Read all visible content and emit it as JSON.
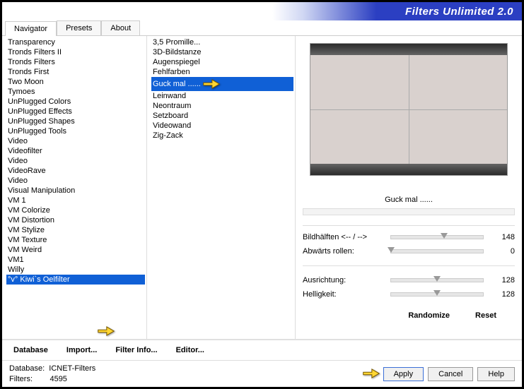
{
  "title": "Filters Unlimited 2.0",
  "tabs": [
    "Navigator",
    "Presets",
    "About"
  ],
  "active_tab": 0,
  "left_list": [
    "Transparency",
    "Tronds Filters II",
    "Tronds Filters",
    "Tronds First",
    "Two Moon",
    "Tymoes",
    "UnPlugged Colors",
    "UnPlugged Effects",
    "UnPlugged Shapes",
    "UnPlugged Tools",
    "Video",
    "Videofilter",
    "Video",
    "VideoRave",
    "Video",
    "Visual Manipulation",
    "VM 1",
    "VM Colorize",
    "VM Distortion",
    "VM Stylize",
    "VM Texture",
    "VM Weird",
    "VM1",
    "Willy",
    "°v° Kiwi`s Oelfilter"
  ],
  "left_selected": 24,
  "mid_list": [
    "3,5 Promille...",
    "3D-Bildstanze",
    "Augenspiegel",
    "Fehlfarben",
    "Guck mal ......",
    "Leinwand",
    "Neontraum",
    "Setzboard",
    "Videowand",
    "Zig-Zack"
  ],
  "mid_selected": 4,
  "bottom_buttons": [
    "Database",
    "Import...",
    "Filter Info...",
    "Editor..."
  ],
  "right_buttons": [
    "Randomize",
    "Reset"
  ],
  "current_filter": "Guck mal ......",
  "params": [
    {
      "label": "Bildhälften <-- / -->",
      "value": 148,
      "pos": 58
    },
    {
      "label": "Abwärts rollen:",
      "value": 0,
      "pos": 0
    },
    {
      "label": "Ausrichtung:",
      "value": 128,
      "pos": 50
    },
    {
      "label": "Helligkeit:",
      "value": 128,
      "pos": 50
    }
  ],
  "status_db_label": "Database:",
  "status_db_value": "ICNET-Filters",
  "status_filters_label": "Filters:",
  "status_filters_value": "4595",
  "footer_buttons": {
    "apply": "Apply",
    "cancel": "Cancel",
    "help": "Help"
  }
}
